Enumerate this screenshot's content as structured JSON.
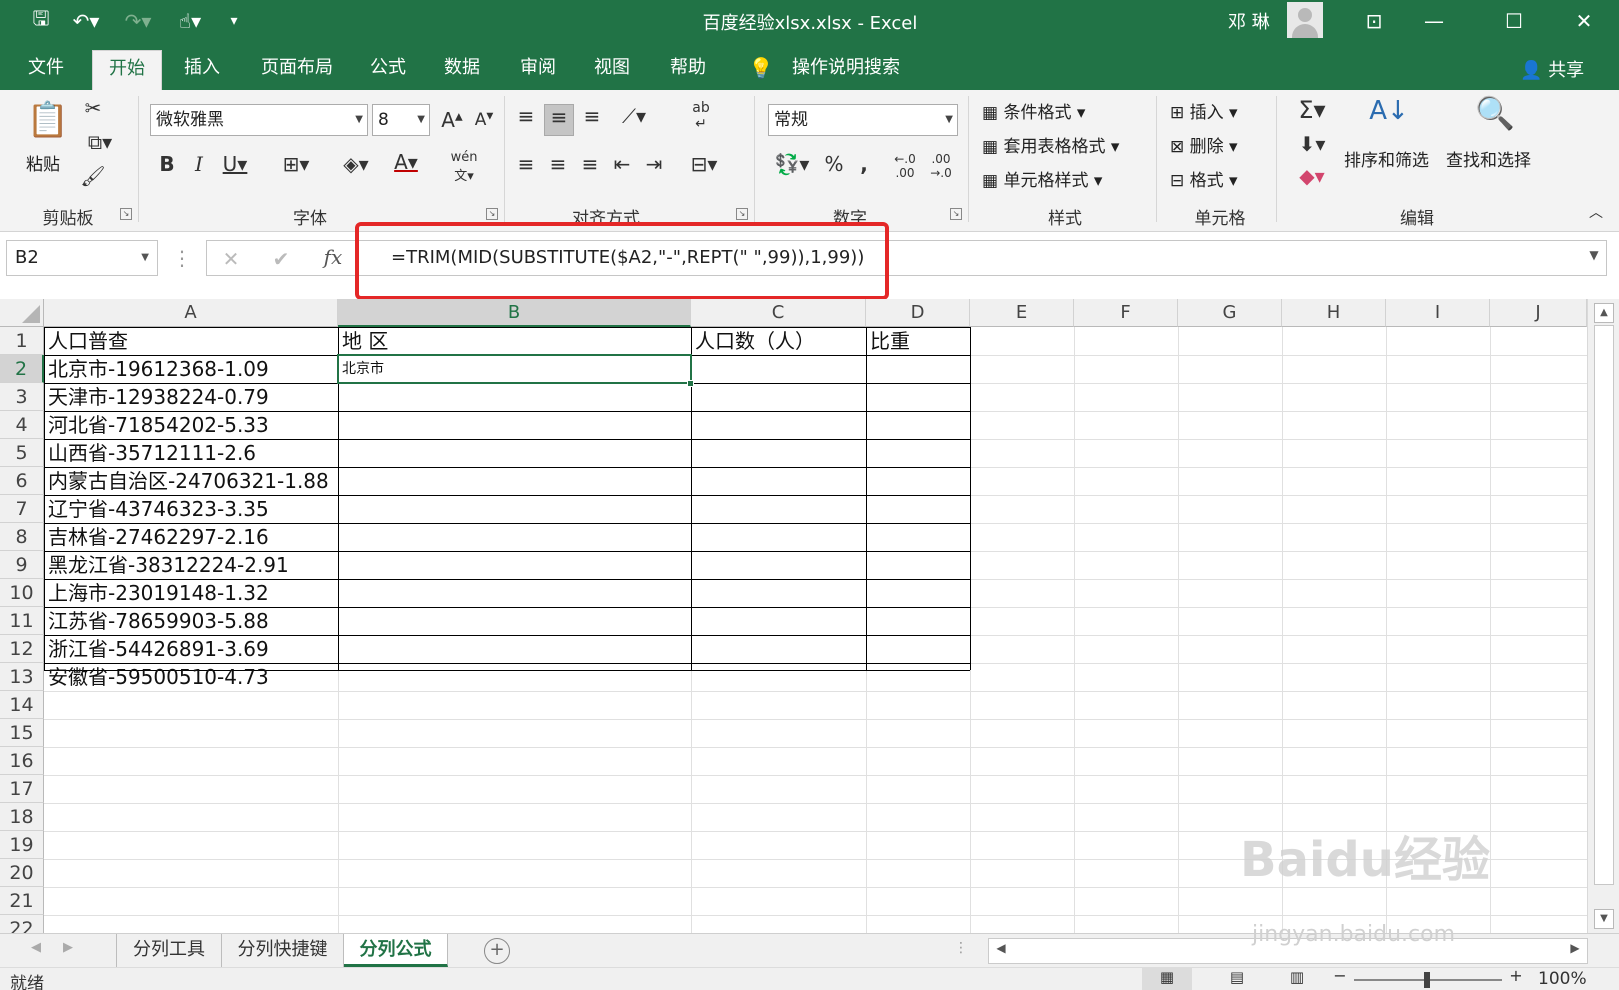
{
  "window": {
    "doc_title": "百度经验xlsx.xlsx  -  Excel",
    "user": "邓 琳"
  },
  "tabs": [
    "文件",
    "开始",
    "插入",
    "页面布局",
    "公式",
    "数据",
    "审阅",
    "视图",
    "帮助"
  ],
  "tell_me": "操作说明搜索",
  "share": "共享",
  "ribbon": {
    "paste": "粘贴",
    "font_name": "微软雅黑",
    "font_size": "8",
    "number_format": "常规",
    "conditional_format": "条件格式",
    "format_as_table": "套用表格格式",
    "cell_styles": "单元格样式",
    "insert": "插入",
    "delete": "删除",
    "format": "格式",
    "sort_filter": "排序和筛选",
    "find_select": "查找和选择",
    "groups": {
      "clipboard": "剪贴板",
      "font": "字体",
      "alignment": "对齐方式",
      "number": "数字",
      "styles": "样式",
      "cells": "单元格",
      "editing": "编辑"
    }
  },
  "formula_bar": {
    "name_box": "B2",
    "formula": "=TRIM(MID(SUBSTITUTE($A2,\"-\",REPT(\" \",99)),1,99))"
  },
  "grid": {
    "columns": [
      "A",
      "B",
      "C",
      "D",
      "E",
      "F",
      "G",
      "H",
      "I",
      "J"
    ],
    "row_numbers": [
      "1",
      "2",
      "3",
      "4",
      "5",
      "6",
      "7",
      "8",
      "9",
      "10",
      "11",
      "12",
      "13",
      "14",
      "15",
      "16",
      "17",
      "18",
      "19",
      "20",
      "21",
      "22"
    ],
    "headers": {
      "a1": "人口普查",
      "b1": "地  区",
      "c1": "人口数（人）",
      "d1": "比重"
    },
    "col_a": [
      "北京市-19612368-1.09",
      "天津市-12938224-0.79",
      "河北省-71854202-5.33",
      "山西省-35712111-2.6",
      "内蒙古自治区-24706321-1.88",
      "辽宁省-43746323-3.35",
      "吉林省-27462297-2.16",
      "黑龙江省-38312224-2.91",
      "上海市-23019148-1.32",
      "江苏省-78659903-5.88",
      "浙江省-54426891-3.69",
      "安徽省-59500510-4.73"
    ],
    "b2": "北京市"
  },
  "sheets": [
    "分列工具",
    "分列快捷键",
    "分列公式"
  ],
  "status": {
    "ready": "就绪",
    "zoom": "100%"
  },
  "watermark": {
    "brand": "Baidu经验",
    "url": "jingyan.baidu.com"
  }
}
